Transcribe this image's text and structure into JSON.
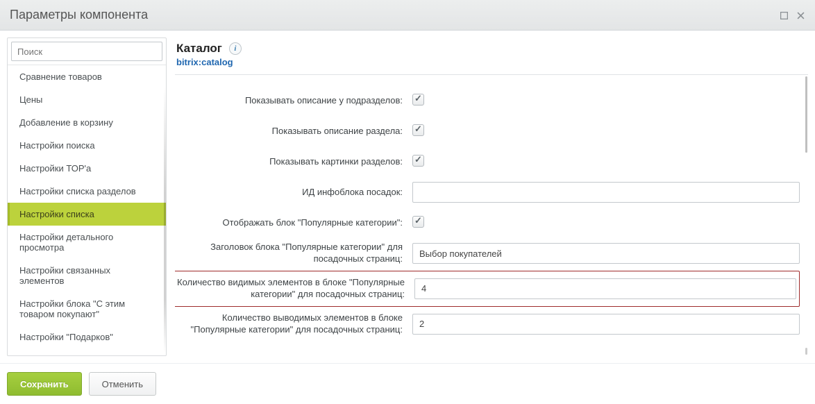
{
  "window": {
    "title": "Параметры компонента"
  },
  "search": {
    "placeholder": "Поиск"
  },
  "tree": {
    "items": [
      {
        "label": "Сравнение товаров"
      },
      {
        "label": "Цены"
      },
      {
        "label": "Добавление в корзину"
      },
      {
        "label": "Настройки поиска"
      },
      {
        "label": "Настройки ТОР'а"
      },
      {
        "label": "Настройки списка разделов"
      },
      {
        "label": "Настройки списка",
        "active": true
      },
      {
        "label": "Настройки детального просмотра"
      },
      {
        "label": "Настройки связанных элементов"
      },
      {
        "label": "Настройки блока \"С этим товаром покупают\""
      },
      {
        "label": "Настройки \"Подарков\""
      }
    ]
  },
  "component": {
    "title": "Каталог",
    "name": "bitrix:catalog"
  },
  "form": {
    "show_subsection_desc": {
      "label": "Показывать описание у подразделов:",
      "checked": true
    },
    "show_section_desc": {
      "label": "Показывать описание раздела:",
      "checked": true
    },
    "show_section_pics": {
      "label": "Показывать картинки разделов:",
      "checked": true
    },
    "landing_iblock_id": {
      "label": "ИД инфоблока посадок:",
      "value": ""
    },
    "show_popular_block": {
      "label": "Отображать блок \"Популярные категории\":",
      "checked": true
    },
    "popular_title": {
      "label": "Заголовок блока \"Популярные категории\" для посадочных страниц:",
      "value": "Выбор покупателей"
    },
    "popular_visible_count": {
      "label": "Количество видимых элементов в блоке \"Популярные категории\" для посадочных страниц:",
      "value": "4"
    },
    "popular_output_count": {
      "label": "Количество выводимых элементов в блоке \"Популярные категории\" для посадочных страниц:",
      "value": "2"
    }
  },
  "footer": {
    "save": "Сохранить",
    "cancel": "Отменить"
  }
}
